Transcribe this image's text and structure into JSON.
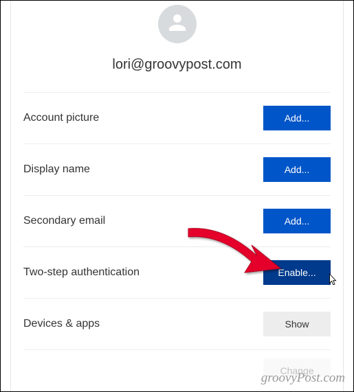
{
  "header": {
    "email": "lori@groovypost.com"
  },
  "rows": [
    {
      "label": "Account picture",
      "button": "Add...",
      "variant": "primary"
    },
    {
      "label": "Display name",
      "button": "Add...",
      "variant": "primary"
    },
    {
      "label": "Secondary email",
      "button": "Add...",
      "variant": "primary"
    },
    {
      "label": "Two-step authentication",
      "button": "Enable...",
      "variant": "primary-dark"
    },
    {
      "label": "Devices & apps",
      "button": "Show",
      "variant": "secondary"
    }
  ],
  "partial": {
    "button": "Change"
  },
  "watermark": "groovyPost.com",
  "colors": {
    "primary": "#0055c8",
    "primary_dark": "#003a8c",
    "secondary": "#ededed"
  }
}
